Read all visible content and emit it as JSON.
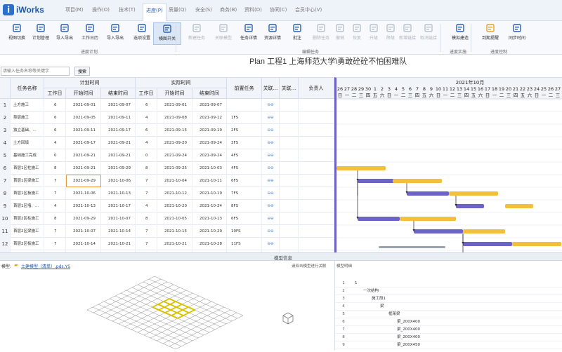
{
  "app": {
    "logo": "iWorks"
  },
  "menu": [
    "项目(M)",
    "操作(O)",
    "技术(T)",
    "进度(P)",
    "质量(Q)",
    "安全(S)",
    "商务(B)",
    "资料(D)",
    "协同(C)",
    "会员中心(V)"
  ],
  "menu_active_index": 3,
  "toolbar": {
    "groups": [
      {
        "label": "进度计划",
        "tools": [
          {
            "label": "视图切换",
            "icon": "layout-icon"
          },
          {
            "label": "计划管理",
            "icon": "plan-icon"
          },
          {
            "label": "导入导出",
            "icon": "import-export-icon"
          },
          {
            "label": "工作日历",
            "icon": "calendar-icon"
          },
          {
            "label": "导入导出",
            "icon": "swap-icon"
          },
          {
            "label": "选项设置",
            "icon": "gear-icon"
          },
          {
            "label": "横图开关",
            "icon": "chart-toggle-icon"
          }
        ]
      },
      {
        "label": "编辑任务",
        "tools": [
          {
            "label": "新建任务",
            "icon": "new-task-icon"
          },
          {
            "label": "关联模型",
            "icon": "link-model-icon"
          },
          {
            "label": "任务详情",
            "icon": "task-detail-icon"
          },
          {
            "label": "资源详情",
            "icon": "resource-icon"
          },
          {
            "label": "批注",
            "icon": "note-icon"
          },
          {
            "label": "删除任务",
            "icon": "delete-icon"
          },
          {
            "label": "撤销",
            "icon": "undo-icon"
          },
          {
            "label": "恢复",
            "icon": "redo-icon"
          },
          {
            "label": "升级",
            "icon": "up-icon"
          },
          {
            "label": "降级",
            "icon": "down-icon"
          },
          {
            "label": "新增链接",
            "icon": "add-link-icon"
          },
          {
            "label": "取消链接",
            "icon": "unlink-icon"
          }
        ]
      },
      {
        "label": "进度实施",
        "tools": [
          {
            "label": "模拟建造",
            "icon": "play-icon"
          }
        ]
      },
      {
        "label": "进度控制",
        "tools": [
          {
            "label": "到期提醒",
            "icon": "reminder-icon"
          },
          {
            "label": "同步时间",
            "icon": "sync-icon"
          }
        ]
      }
    ]
  },
  "plan_title": "Plan 工程1 上海师范大学\\勇敢砼砼不怕困难队",
  "search": {
    "placeholder": "请输入任务名称等关键字",
    "button": "搜索"
  },
  "grid": {
    "col_task": "任务名称",
    "col_plan": "计划时间",
    "col_actual": "实际时间",
    "col_days": "工作日",
    "col_start": "开始时间",
    "col_end": "结束时间",
    "col_pre": "前置任务",
    "col_link1": "关联...",
    "col_link2": "关联...",
    "col_owner": "负责人",
    "link_glyph": "⊖⊖",
    "rows": [
      {
        "no": "1",
        "name": "土方施工",
        "pd": "6",
        "ps": "2021-09-01",
        "pe": "2021-09-07",
        "ad": "6",
        "as": "2021-09-01",
        "ae": "2021-09-07",
        "pre": ""
      },
      {
        "no": "2",
        "name": "垫层施工",
        "pd": "6",
        "ps": "2021-09-05",
        "pe": "2021-09-11",
        "ad": "4",
        "as": "2021-09-08",
        "ae": "2021-09-12",
        "pre": "1FS"
      },
      {
        "no": "3",
        "name": "独立基础、...",
        "pd": "6",
        "ps": "2021-09-11",
        "pe": "2021-09-17",
        "ad": "6",
        "as": "2021-09-15",
        "ae": "2021-09-19",
        "pre": "2FS"
      },
      {
        "no": "4",
        "name": "土方回填",
        "pd": "4",
        "ps": "2021-09-17",
        "pe": "2021-09-21",
        "ad": "4",
        "as": "2021-09-20",
        "ae": "2021-09-24",
        "pre": "3FS"
      },
      {
        "no": "5",
        "name": "基础施工完成",
        "pd": "0",
        "ps": "2021-09-21",
        "pe": "2021-09-21",
        "ad": "0",
        "as": "2021-09-24",
        "ae": "2021-09-24",
        "pre": "4FS"
      },
      {
        "no": "6",
        "name": "首层1区柱施工",
        "pd": "8",
        "ps": "2021-09-21",
        "pe": "2021-09-29",
        "ad": "8",
        "as": "2021-09-25",
        "ae": "2021-10-03",
        "pre": "4FS"
      },
      {
        "no": "7",
        "name": "首层1区梁施工",
        "pd": "7",
        "ps": "2021-09-29",
        "pe": "2021-10-06",
        "ad": "7",
        "as": "2021-10-04",
        "ae": "2021-10-11",
        "pre": "6FS"
      },
      {
        "no": "8",
        "name": "首层1区板施工",
        "pd": "7",
        "ps": "2021-10-06",
        "pe": "2021-10-13",
        "ad": "7",
        "as": "2021-10-12",
        "ae": "2021-10-19",
        "pre": "7FS"
      },
      {
        "no": "9",
        "name": "首层1区墙、...",
        "pd": "4",
        "ps": "2021-10-13",
        "pe": "2021-10-17",
        "ad": "4",
        "as": "2021-10-20",
        "ae": "2021-10-24",
        "pre": "8FS"
      },
      {
        "no": "10",
        "name": "首层2区柱施工",
        "pd": "8",
        "ps": "2021-09-29",
        "pe": "2021-10-07",
        "ad": "8",
        "as": "2021-10-05",
        "ae": "2021-10-13",
        "pre": "6FS"
      },
      {
        "no": "11",
        "name": "首层2区梁施工",
        "pd": "7",
        "ps": "2021-10-07",
        "pe": "2021-10-14",
        "ad": "7",
        "as": "2021-10-15",
        "ae": "2021-10-20",
        "pre": "10FS"
      },
      {
        "no": "12",
        "name": "首层2区板施工",
        "pd": "7",
        "ps": "2021-10-14",
        "pe": "2021-10-21",
        "ad": "7",
        "as": "2021-10-21",
        "ae": "2021-10-28",
        "pre": "11FS"
      },
      {
        "no": "13",
        "name": "二层1区柱施工",
        "pd": "8",
        "ps": "2021-10-14",
        "pe": "2021-10-22",
        "ad": "8",
        "as": "2021-10-21",
        "ae": "2021-10-29",
        "pre": "11FS"
      },
      {
        "no": "14",
        "name": "首层2区墙、...",
        "pd": "4",
        "ps": "2021-10-21",
        "pe": "2021-10-25",
        "ad": "4",
        "as": "2021-10-29",
        "ae": "2021-11-02",
        "pre": "12FS"
      },
      {
        "no": "15",
        "name": "首层2区柱施工",
        "pd": "8",
        "ps": "2021-10-21",
        "pe": "2021-10-29",
        "ad": "8",
        "as": "2021-10-29",
        "ae": "2021-11-06",
        "pre": "13FS"
      }
    ]
  },
  "gantt": {
    "month": "2021年10月",
    "days": [
      "26",
      "27",
      "28",
      "29",
      "30",
      "1",
      "2",
      "3",
      "4",
      "5",
      "6",
      "7",
      "8",
      "9",
      "10",
      "11",
      "12",
      "13",
      "14",
      "15",
      "16",
      "17",
      "18",
      "19",
      "20",
      "21",
      "22",
      "23",
      "24",
      "25",
      "26",
      "27"
    ],
    "weekdays": [
      "日",
      "一",
      "二",
      "三",
      "四",
      "五",
      "六",
      "日",
      "一",
      "二",
      "三",
      "四",
      "五",
      "六",
      "日",
      "一",
      "二",
      "三",
      "四",
      "五",
      "六",
      "日",
      "一",
      "二",
      "三",
      "四",
      "五",
      "六",
      "日",
      "一",
      "二",
      "三"
    ],
    "plan_color": "#f3c03b",
    "actual_color": "#6c63c9",
    "bars": [
      {
        "row": 5,
        "type": "plan",
        "start": "2021-09-26",
        "end": "2021-10-03"
      },
      {
        "row": 6,
        "type": "actual",
        "start": "2021-09-29",
        "end": "2021-10-06"
      },
      {
        "row": 6,
        "type": "plan",
        "start": "2021-10-04",
        "end": "2021-10-11"
      },
      {
        "row": 7,
        "type": "actual",
        "start": "2021-10-06",
        "end": "2021-10-12"
      },
      {
        "row": 7,
        "type": "plan",
        "start": "2021-10-12",
        "end": "2021-10-19"
      },
      {
        "row": 8,
        "type": "actual",
        "start": "2021-10-13",
        "end": "2021-10-17"
      },
      {
        "row": 8,
        "type": "plan",
        "start": "2021-10-20",
        "end": "2021-10-24"
      },
      {
        "row": 9,
        "type": "actual",
        "start": "2021-09-29",
        "end": "2021-10-05"
      },
      {
        "row": 9,
        "type": "plan",
        "start": "2021-10-05",
        "end": "2021-10-13"
      },
      {
        "row": 10,
        "type": "actual",
        "start": "2021-10-07",
        "end": "2021-10-14"
      },
      {
        "row": 10,
        "type": "plan",
        "start": "2021-10-14",
        "end": "2021-10-20"
      },
      {
        "row": 11,
        "type": "actual",
        "start": "2021-10-14",
        "end": "2021-10-21"
      },
      {
        "row": 11,
        "type": "plan",
        "start": "2021-10-21",
        "end": "2021-10-28"
      },
      {
        "row": 12,
        "type": "actual",
        "start": "2021-10-14",
        "end": "2021-10-22"
      },
      {
        "row": 12,
        "type": "plan",
        "start": "2021-10-21",
        "end": "2021-10-29"
      },
      {
        "row": 13,
        "type": "actual",
        "start": "2021-10-21",
        "end": "2021-10-25"
      }
    ]
  },
  "model": {
    "bar_title": "模型信息",
    "label": "模型:",
    "file": "土建模型（清单）.pds.YS",
    "tab1": "请双击模型进行关联",
    "tab2": "模型明细",
    "tree": [
      {
        "n": "1",
        "text": "1",
        "indent": 0
      },
      {
        "n": "2",
        "text": "一次结构",
        "indent": 1
      },
      {
        "n": "3",
        "text": "施工段1",
        "indent": 2
      },
      {
        "n": "4",
        "text": "梁",
        "indent": 3
      },
      {
        "n": "5",
        "text": "框架梁",
        "indent": 4
      },
      {
        "n": "6",
        "text": "梁_200X400",
        "indent": 5
      },
      {
        "n": "7",
        "text": "梁_200X400",
        "indent": 5
      },
      {
        "n": "8",
        "text": "梁_200X400",
        "indent": 5
      },
      {
        "n": "9",
        "text": "梁_200X450",
        "indent": 5
      }
    ]
  }
}
